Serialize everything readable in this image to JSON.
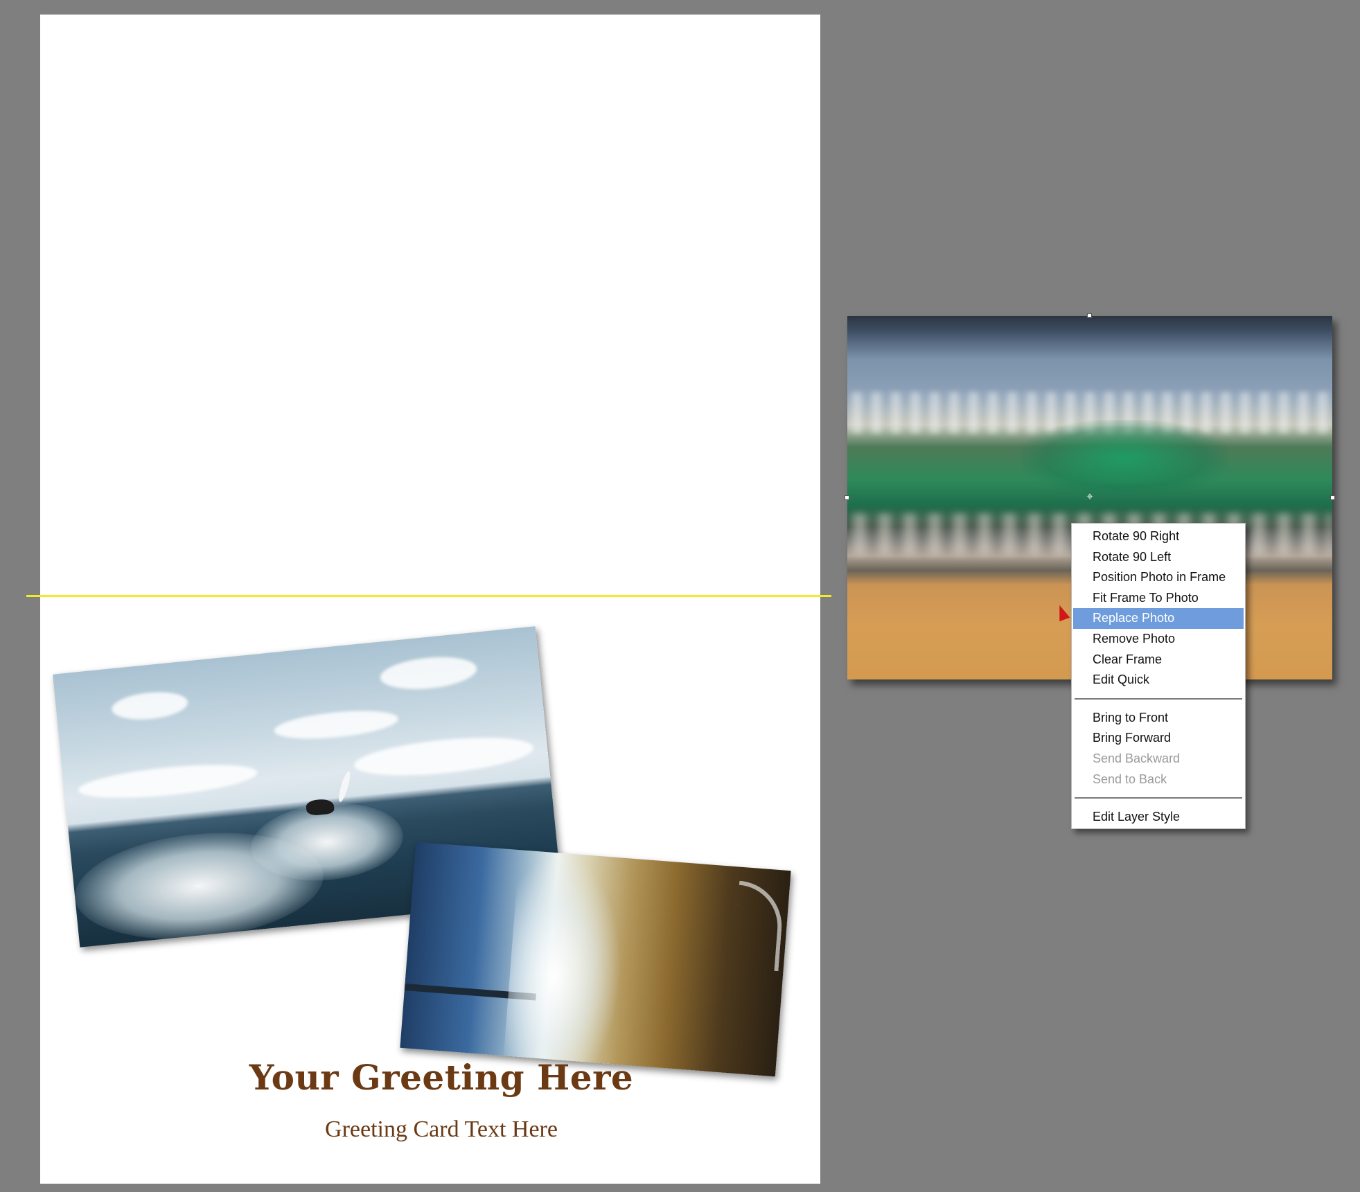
{
  "card": {
    "greeting_title": "Your Greeting Here",
    "greeting_subtitle": "Greeting Card Text Here"
  },
  "context_menu": {
    "group1": [
      {
        "label": "Rotate 90 Right",
        "state": "enabled"
      },
      {
        "label": "Rotate 90 Left",
        "state": "enabled"
      },
      {
        "label": "Position Photo in Frame",
        "state": "enabled"
      },
      {
        "label": "Fit Frame To Photo",
        "state": "enabled"
      },
      {
        "label": "Replace Photo",
        "state": "highlighted"
      },
      {
        "label": "Remove Photo",
        "state": "enabled"
      },
      {
        "label": "Clear Frame",
        "state": "enabled"
      },
      {
        "label": "Edit Quick",
        "state": "enabled"
      }
    ],
    "group2": [
      {
        "label": "Bring to Front",
        "state": "enabled"
      },
      {
        "label": "Bring Forward",
        "state": "enabled"
      },
      {
        "label": "Send Backward",
        "state": "disabled"
      },
      {
        "label": "Send to Back",
        "state": "disabled"
      }
    ],
    "group3": [
      {
        "label": "Edit Layer Style",
        "state": "enabled"
      }
    ]
  },
  "colors": {
    "canvas_background": "#7f7f7f",
    "fold_line": "#f4ea2a",
    "greeting_text": "#6b3a14",
    "menu_highlight": "#6f9cdc"
  }
}
